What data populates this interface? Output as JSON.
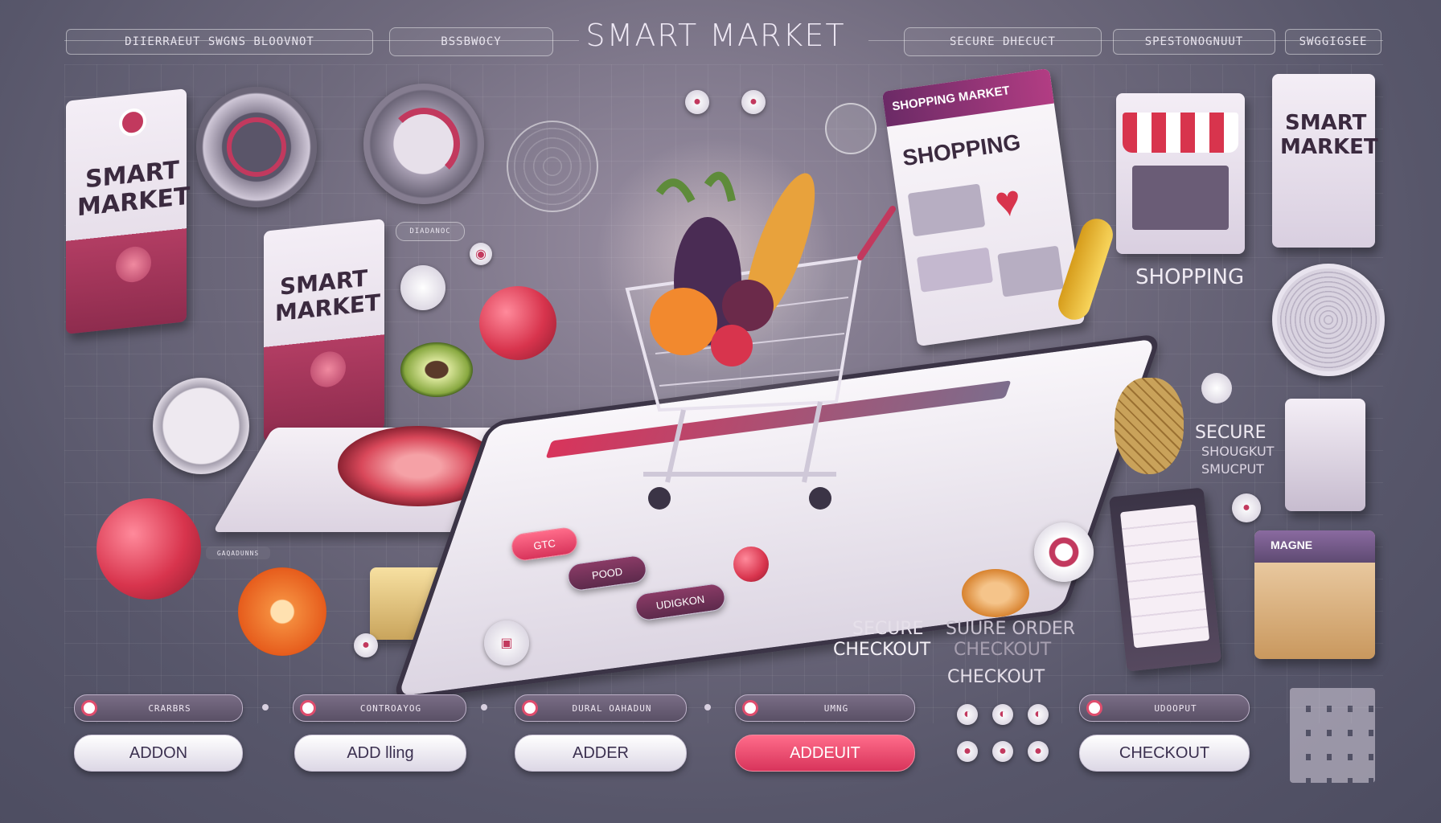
{
  "header": {
    "title": "SMART MARKET",
    "tabs": [
      "DIIERRAEUT SWGNS  BLOOVNOT",
      "BSSBWOCY",
      "SECURE DHECUCT",
      "SPESTONOGNUUT",
      "SWGGIGSEE"
    ]
  },
  "bags": [
    {
      "line1": "SMART",
      "line2": "MARKET"
    },
    {
      "line1": "SMART",
      "line2": "MARKET"
    },
    {
      "line1": "SMART",
      "line2": "MARKET"
    }
  ],
  "shop_window": {
    "banner": "SHOPPING MARKET",
    "heading": "SHOPPING"
  },
  "side_labels": {
    "shopping": "SHOPPING",
    "secure": "SECURE",
    "secure2": "SHOUGKUT",
    "secure3": "SMUCPUT"
  },
  "checkout_labels": {
    "line1_a": "SECURE",
    "line1_b": "SUURE ORDER",
    "line2_a": "CHECKOUT",
    "line2_b": "CHECKOUT",
    "line3": "CHECKOUT"
  },
  "small_tags": {
    "tag1": "DIADANOC",
    "tag2": "GAQADUNNS",
    "box_label": "MAGNE"
  },
  "tablet_buttons": [
    "GTC",
    "POOD",
    "UDIGKON"
  ],
  "bottom_bars": [
    "CRARBRS",
    "CONTROAYOG",
    "DURAL OAHADUN",
    "UMNG",
    "UDOOPUT"
  ],
  "bottom_buttons": [
    {
      "label": "ADDON",
      "highlight": false
    },
    {
      "label": "ADD lling",
      "highlight": false
    },
    {
      "label": "ADDER",
      "highlight": false
    },
    {
      "label": "ADDEUIT",
      "highlight": true
    },
    {
      "label": "CHECKOUT",
      "highlight": false
    }
  ],
  "colors": {
    "accent": "#d8345b",
    "background": "#57566a",
    "panel": "#f3eef5"
  }
}
